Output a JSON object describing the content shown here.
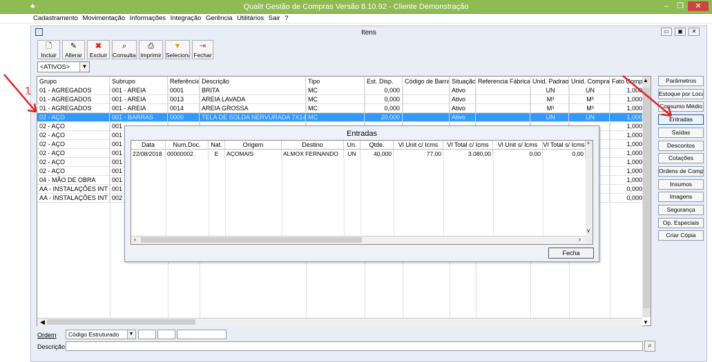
{
  "app": {
    "title": "Qualit Gestão de Compras Versão 8.10.92 - Cliente Demonstração"
  },
  "menu": [
    "Cadastramento",
    "Movimentação",
    "Informações",
    "Integração",
    "Gerência",
    "Utilitários",
    "Sair",
    "?"
  ],
  "window": {
    "title": "Itens"
  },
  "toolbar": [
    "Incluir",
    "Alterar",
    "Excluir",
    "Consultar",
    "Imprimir",
    "Seleciona",
    "Fechar"
  ],
  "filter": {
    "value": "<ATIVOS>"
  },
  "grid": {
    "headers": [
      "Grupo",
      "Subrupo",
      "Referência",
      "Descrição",
      "Tipo",
      "Est. Disp.",
      "Código de Barra",
      "Situação",
      "Referencia Fábrica",
      "Unid. Padrao",
      "Unid. Compra",
      "Fato Compra"
    ],
    "rows": [
      [
        "01 - AGREGADOS",
        "001 - AREIA",
        "0001",
        "BRITA",
        "MC",
        "0,000",
        "",
        "Ativo",
        "",
        "UN",
        "UN",
        "1,000"
      ],
      [
        "01 - AGREGADOS",
        "001 - AREIA",
        "0013",
        "AREIA LAVADA",
        "MC",
        "0,000",
        "",
        "Ativo",
        "",
        "M³",
        "M³",
        "1,000"
      ],
      [
        "01 - AGREGADOS",
        "001 - AREIA",
        "0014",
        "AREIA GROSSA",
        "MC",
        "0,000",
        "",
        "Ativo",
        "",
        "M³",
        "M³",
        "1,000"
      ],
      [
        "02 - AÇO",
        "001 - BARRAS",
        "0000",
        "TELA DE SOLDA NERVURADA 7X14",
        "MC",
        "20,000",
        "",
        "Ativo",
        "",
        "UN",
        "UN",
        "1,000"
      ],
      [
        "02 - AÇO",
        "001",
        "",
        "",
        "",
        "",
        "",
        "",
        "",
        "",
        "",
        "1,000"
      ],
      [
        "02 - AÇO",
        "001",
        "",
        "",
        "",
        "",
        "",
        "",
        "",
        "",
        "",
        "1,000"
      ],
      [
        "02 - AÇO",
        "001",
        "",
        "",
        "",
        "",
        "",
        "",
        "",
        "",
        "",
        "1,000"
      ],
      [
        "02 - AÇO",
        "001",
        "",
        "",
        "",
        "",
        "",
        "",
        "",
        "",
        "",
        "1,000"
      ],
      [
        "02 - AÇO",
        "001",
        "",
        "",
        "",
        "",
        "",
        "",
        "",
        "",
        "",
        "1,000"
      ],
      [
        "02 - AÇO",
        "001",
        "",
        "",
        "",
        "",
        "",
        "",
        "",
        "",
        "",
        "1,000"
      ],
      [
        "04 - MÃO DE OBRA",
        "001",
        "",
        "",
        "",
        "",
        "",
        "",
        "",
        "",
        "",
        "1,000"
      ],
      [
        "AA - INSTALAÇÕES INT",
        "001",
        "",
        "",
        "",
        "",
        "",
        "",
        "",
        "",
        "",
        "0,000"
      ],
      [
        "AA - INSTALAÇÕES INT",
        "002",
        "",
        "",
        "",
        "",
        "",
        "",
        "",
        "",
        "",
        "0,000"
      ]
    ],
    "selected_row": 3
  },
  "annotation": "1",
  "side_buttons": [
    "Parâmetros",
    "Estoque por Local",
    "Consumo Médio",
    "Entradas",
    "Saídas",
    "Descontos",
    "Cotações",
    "Ordens de Compra",
    "Insumos",
    "Imagens",
    "Segurança",
    "Op. Especiais",
    "Criar Cópia"
  ],
  "ordem": {
    "label": "Ordem",
    "value": "Código Estruturado"
  },
  "descricao": {
    "label": "Descrição",
    "value": ""
  },
  "dialog": {
    "title": "Entradas",
    "headers": [
      "Data",
      "Num.Doc.",
      "Nat.",
      "Origem",
      "Destino",
      "Un.",
      "Qtde.",
      "Vl Unit c/ Icms",
      "Vl Total c/ Icms",
      "Vl Unit s/ Icms",
      "Vl Total s/ Icms"
    ],
    "rows": [
      [
        "22/08/2018",
        "00000002",
        "E",
        "AÇOMAIS",
        "ALMOX FERNANDO",
        "UN",
        "40,000",
        "77,00",
        "3.080,00",
        "0,00",
        "0,00"
      ]
    ],
    "close_label": "Fecha"
  },
  "colors": {
    "titlebar": "#8fbc52",
    "selection": "#3399ff"
  }
}
